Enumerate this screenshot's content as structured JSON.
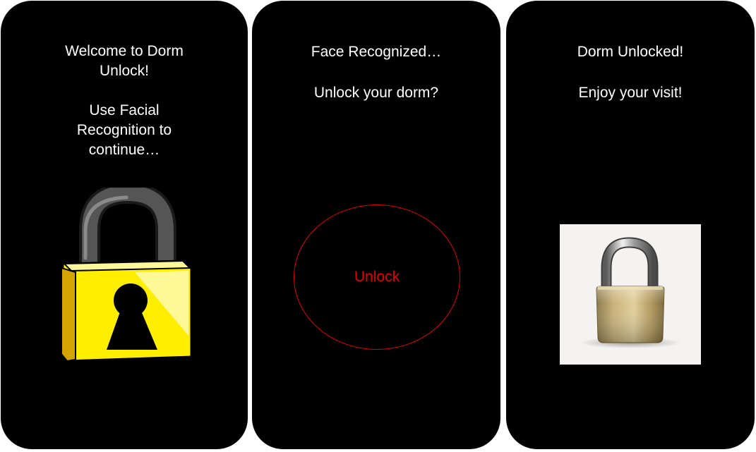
{
  "screens": [
    {
      "welcome": "Welcome to Dorm Unlock!",
      "instruction": "Use Facial Recognition to continue…",
      "image": "locked-padlock-icon"
    },
    {
      "status": "Face Recognized…",
      "question": "Unlock your dorm?",
      "button_label": "Unlock"
    },
    {
      "status": "Dorm Unlocked!",
      "message": "Enjoy your visit!",
      "image": "unlocked-padlock-icon"
    }
  ],
  "colors": {
    "screen_background": "#000000",
    "text": "#ffffff",
    "unlock_accent": "#e00000",
    "lock_body": "#ffee00",
    "page_background": "#ffffff"
  }
}
